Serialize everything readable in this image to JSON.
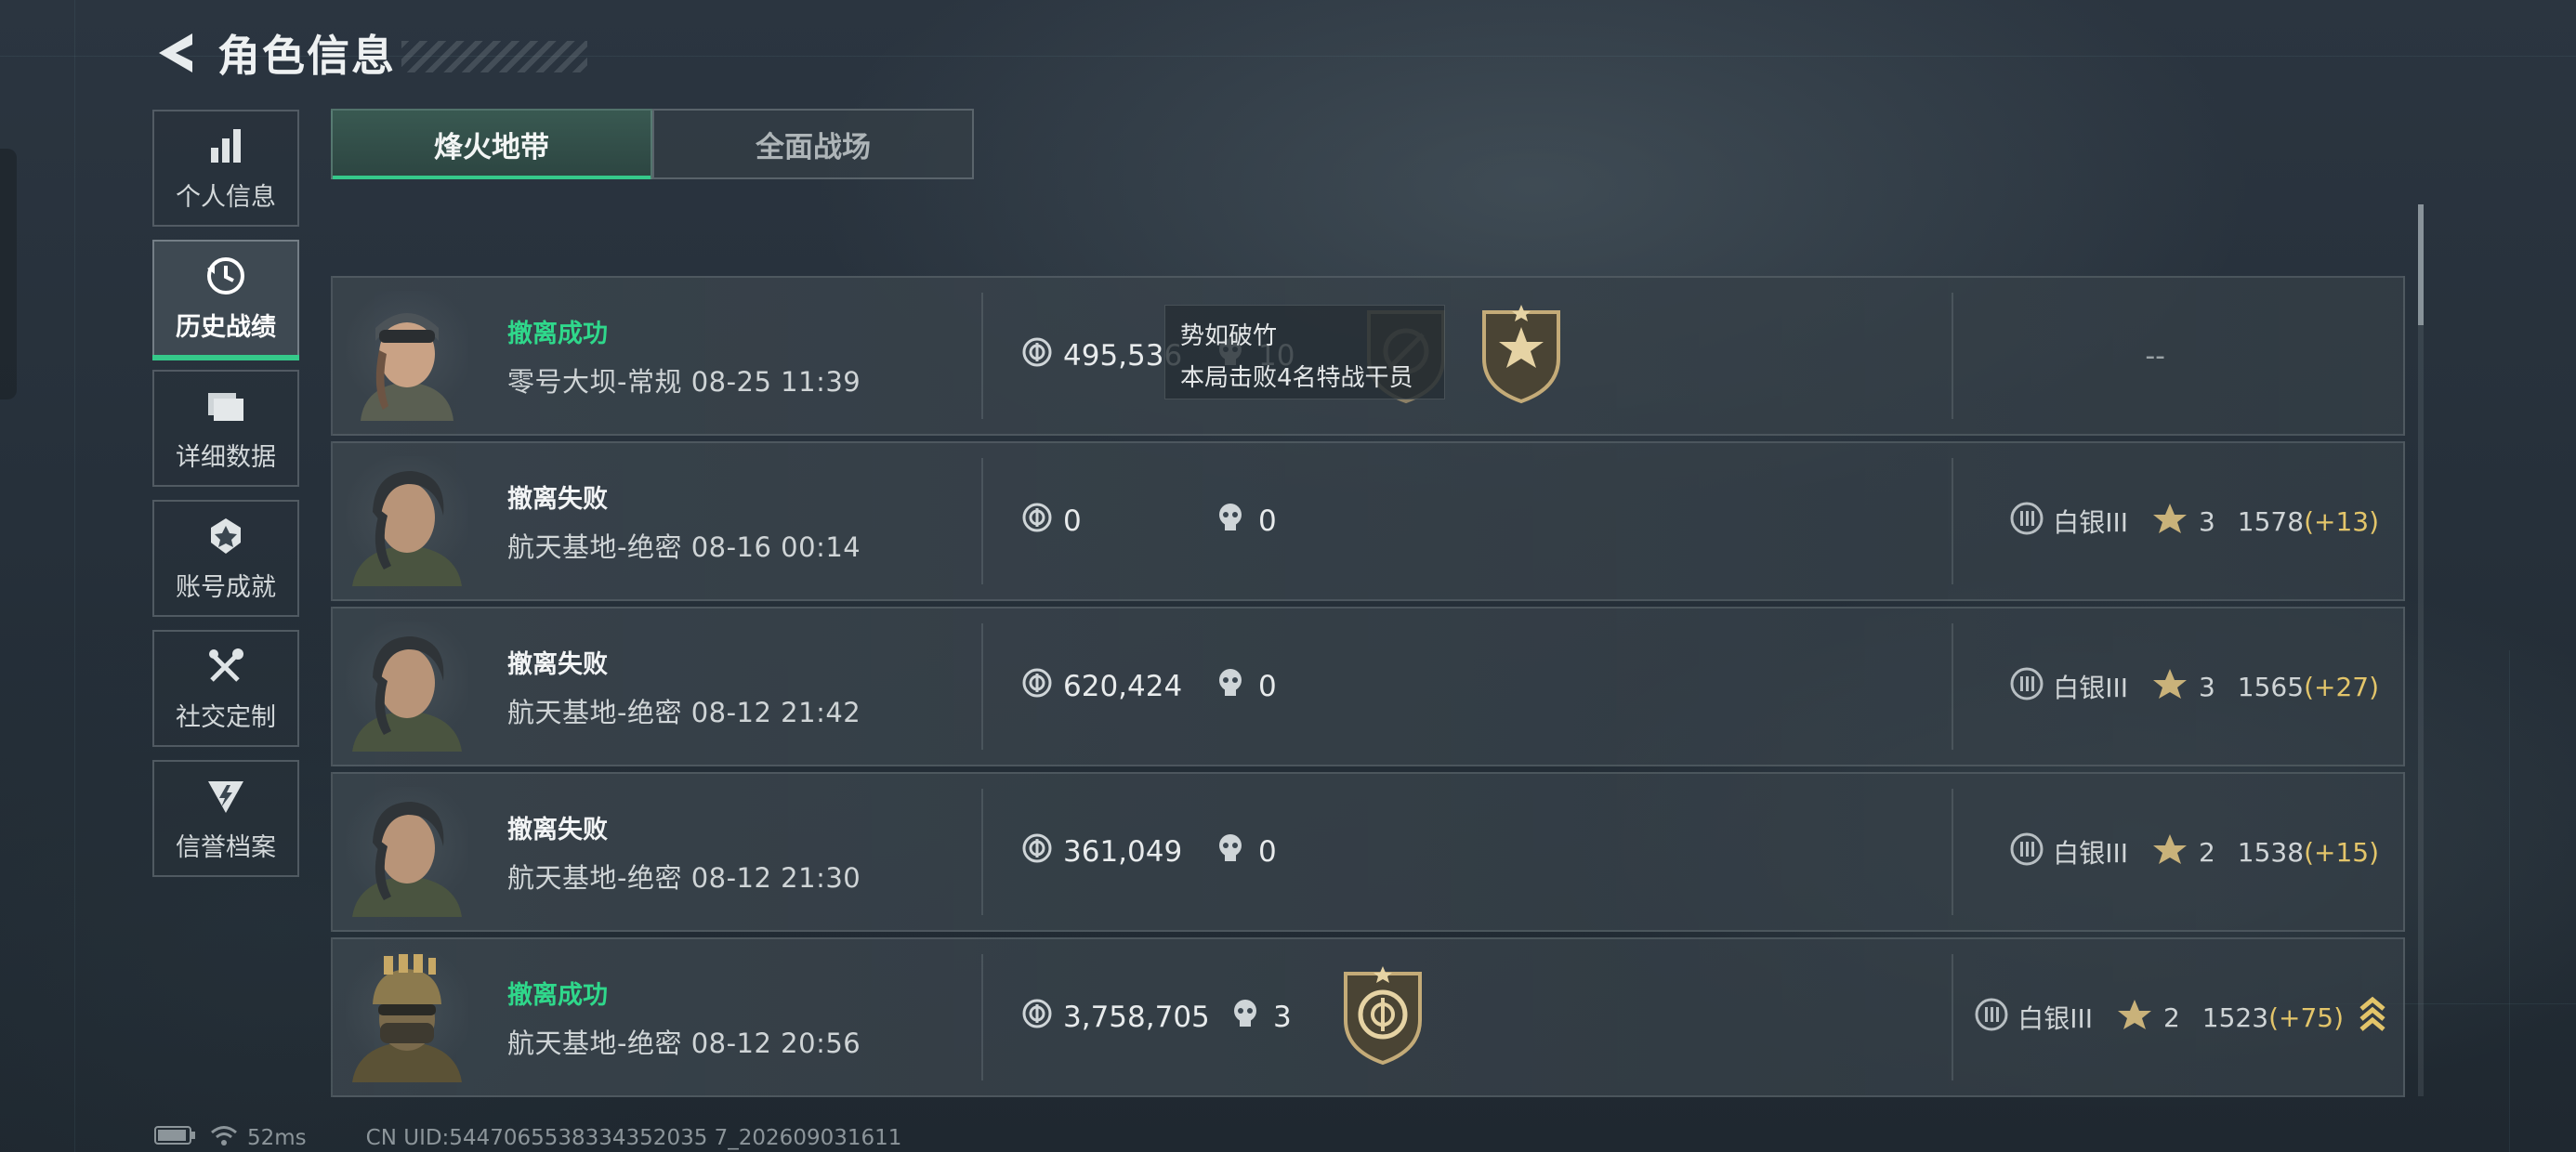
{
  "header": {
    "title": "角色信息"
  },
  "sidebar": {
    "items": [
      {
        "label": "个人信息",
        "icon": "bar-chart-icon"
      },
      {
        "label": "历史战绩",
        "icon": "history-icon",
        "active": true
      },
      {
        "label": "详细数据",
        "icon": "folder-icon"
      },
      {
        "label": "账号成就",
        "icon": "achievement-icon"
      },
      {
        "label": "社交定制",
        "icon": "tools-icon"
      },
      {
        "label": "信誉档案",
        "icon": "credit-icon"
      }
    ]
  },
  "tabs": [
    {
      "label": "烽火地带",
      "active": true
    },
    {
      "label": "全面战场",
      "active": false
    }
  ],
  "matches": [
    {
      "status": "撤离成功",
      "success": true,
      "map": "零号大坝-常规",
      "time": "08-25 11:39",
      "coins": "495,536",
      "kills": "10",
      "badges": [
        "skull-badge",
        "star-emblem-badge"
      ],
      "rank": null,
      "rank_placeholder": "--"
    },
    {
      "status": "撤离失败",
      "success": false,
      "map": "航天基地-绝密",
      "time": "08-16 00:14",
      "coins": "0",
      "kills": "0",
      "badges": [],
      "rank": {
        "tier": "白银III",
        "stars": "3",
        "score": "1578",
        "delta": "(+13)"
      }
    },
    {
      "status": "撤离失败",
      "success": false,
      "map": "航天基地-绝密",
      "time": "08-12 21:42",
      "coins": "620,424",
      "kills": "0",
      "badges": [],
      "rank": {
        "tier": "白银III",
        "stars": "3",
        "score": "1565",
        "delta": "(+27)"
      }
    },
    {
      "status": "撤离失败",
      "success": false,
      "map": "航天基地-绝密",
      "time": "08-12 21:30",
      "coins": "361,049",
      "kills": "0",
      "badges": [],
      "rank": {
        "tier": "白银III",
        "stars": "2",
        "score": "1538",
        "delta": "(+15)"
      }
    },
    {
      "status": "撤离成功",
      "success": true,
      "map": "航天基地-绝密",
      "time": "08-12 20:56",
      "coins": "3,758,705",
      "kills": "3",
      "badges": [
        "coin-emblem-badge"
      ],
      "rank": {
        "tier": "白银III",
        "stars": "2",
        "score": "1523",
        "delta": "(+75)",
        "promo_icon": true
      }
    }
  ],
  "tooltip": {
    "title": "势如破竹",
    "desc": "本局击败4名特战干员"
  },
  "footer": {
    "ping": "52ms",
    "uid": "CN UID:5447065538334352035 7_202609031611"
  },
  "colors": {
    "accent_green": "#35c98a",
    "success_text": "#2fd88b",
    "delta_gold": "#e3c56a"
  }
}
